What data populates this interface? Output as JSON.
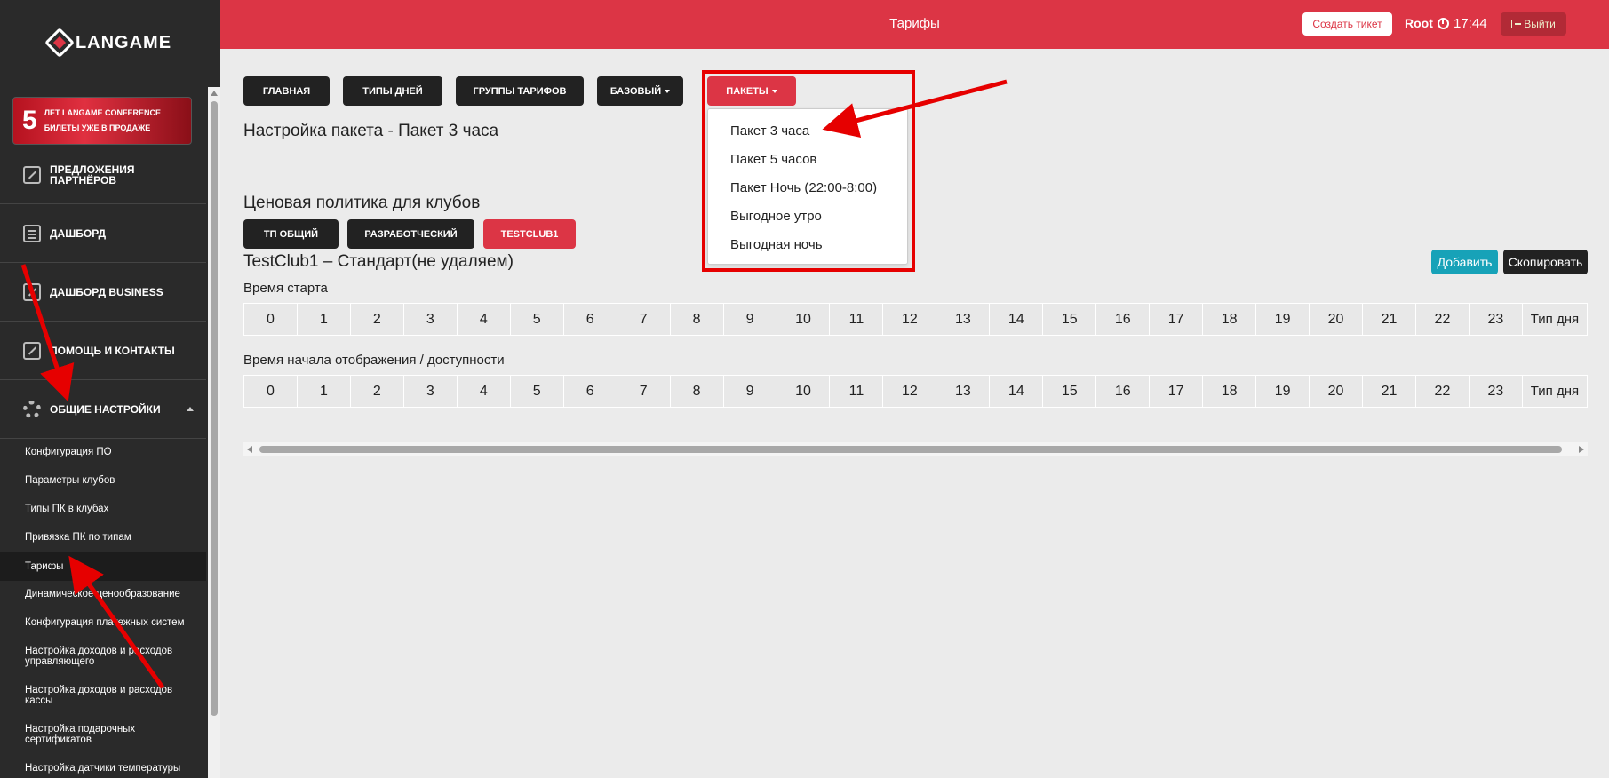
{
  "brand": {
    "name": "LANGAME"
  },
  "promo": {
    "number": "5",
    "line1": "лет LANGAME CONFERENCE",
    "line2": "Билеты уже в продаже"
  },
  "sidebar": {
    "menu": [
      {
        "label": "Предложения партнёров",
        "icon": "edit-icon"
      },
      {
        "label": "Дашборд",
        "icon": "book-icon"
      },
      {
        "label": "Дашборд BUSINESS",
        "icon": "edit-icon"
      },
      {
        "label": "Помощь и контакты",
        "icon": "edit-icon"
      },
      {
        "label": "Общие настройки",
        "icon": "gear-icon"
      }
    ],
    "submenu": [
      "Конфигурация ПО",
      "Параметры клубов",
      "Типы ПК в клубах",
      "Привязка ПК по типам",
      "Тарифы",
      "Динамическое ценообразование",
      "Конфигурация платежных систем",
      "Настройка доходов и расходов управляющего",
      "Настройка доходов и расходов кассы",
      "Настройка подарочных сертификатов",
      "Настройка датчики температуры"
    ],
    "active_submenu": "Тарифы"
  },
  "header": {
    "title": "Тарифы",
    "ticket_button": "Создать тикет",
    "user": "Root",
    "time": "17:44",
    "exit_button": "Выйти",
    "accent_color": "#dc3545"
  },
  "nav": {
    "tabs": [
      "Главная",
      "Типы дней",
      "Группы тарифов",
      "Базовый",
      "Пакеты"
    ],
    "active": "Пакеты"
  },
  "packages_dropdown": [
    "Пакет 3 часа",
    "Пакет 5 часов",
    "Пакет Ночь (22:00-8:00)",
    "Выгодное утро",
    "Выгодная ночь"
  ],
  "main": {
    "package_title": "Настройка пакета - Пакет 3 часа",
    "pricing_title": "Ценовая политика для клубов",
    "clubs": [
      "ТП общий",
      "Разработческий",
      "TestClub1"
    ],
    "active_club": "TestClub1",
    "tariff_title": "TestClub1 – Стандарт(не удаляем)",
    "add_button": "Добавить",
    "copy_button": "Скопировать",
    "start_time_label": "Время старта",
    "display_time_label": "Время начала отображения / доступности",
    "hours": [
      "0",
      "1",
      "2",
      "3",
      "4",
      "5",
      "6",
      "7",
      "8",
      "9",
      "10",
      "11",
      "12",
      "13",
      "14",
      "15",
      "16",
      "17",
      "18",
      "19",
      "20",
      "21",
      "22",
      "23"
    ],
    "day_type_header": "Тип дня"
  }
}
